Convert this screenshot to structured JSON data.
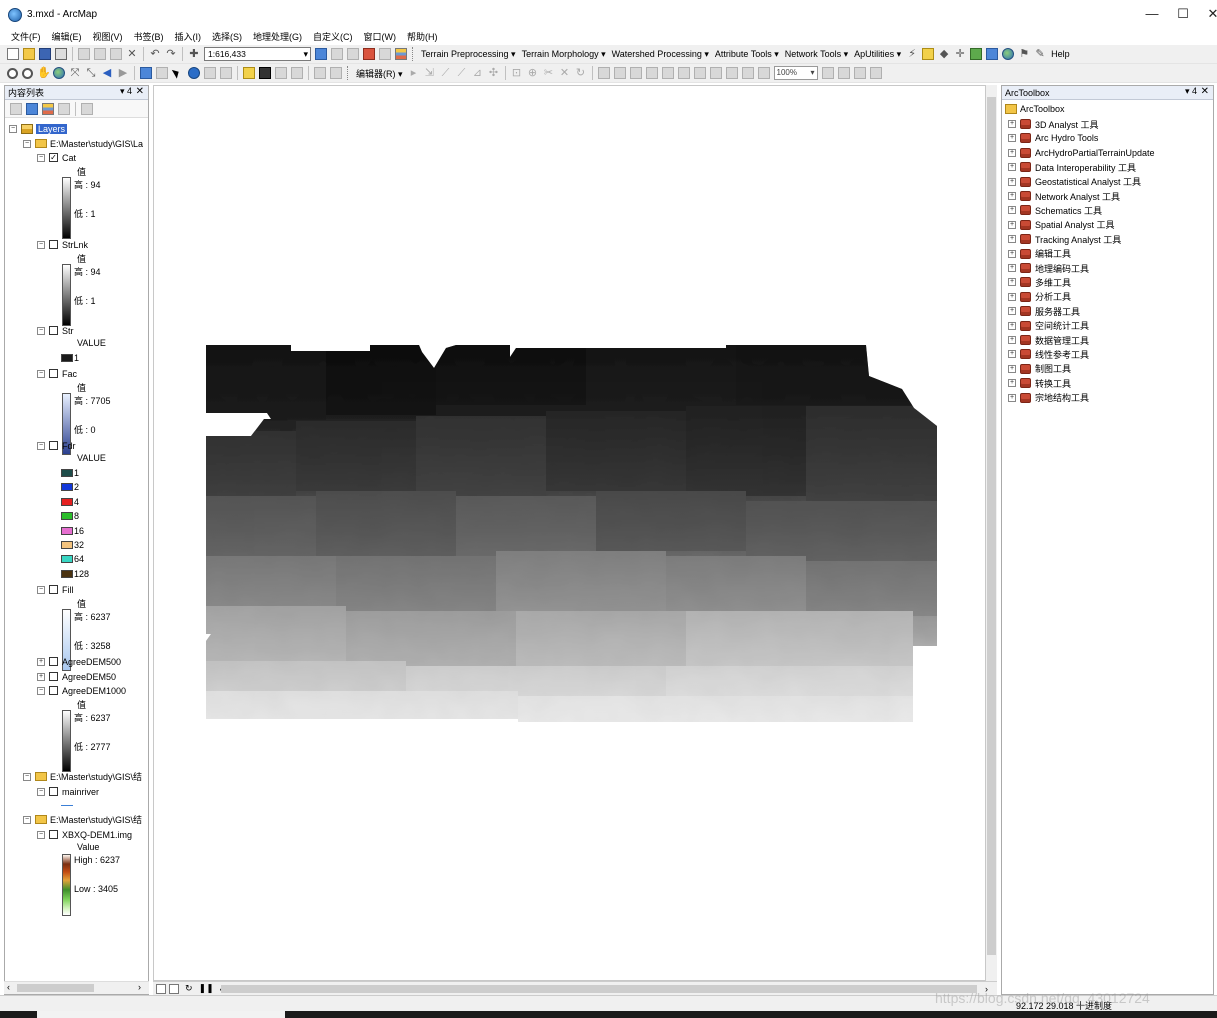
{
  "window": {
    "title": "3.mxd - ArcMap",
    "min": "—",
    "max": "☐",
    "close": "✕"
  },
  "menu": [
    "文件(F)",
    "编辑(E)",
    "视图(V)",
    "书签(B)",
    "插入(I)",
    "选择(S)",
    "地理处理(G)",
    "自定义(C)",
    "窗口(W)",
    "帮助(H)"
  ],
  "toolbar1": {
    "scale": "1:616,433",
    "menus": [
      "Terrain Preprocessing ▾",
      "Terrain Morphology ▾",
      "Watershed Processing ▾",
      "Attribute Tools ▾",
      "Network Tools ▾",
      "ApUtilities ▾"
    ],
    "help": "Help"
  },
  "toolbar2": {
    "editor": "编辑器(R) ▾",
    "zoom": "100%"
  },
  "toc": {
    "title": "内容列表",
    "pin": "▾ 4",
    "close": "✕",
    "root": "Layers",
    "groups": [
      {
        "path": "E:\\Master\\study\\GIS\\La"
      },
      {
        "path": "E:\\Master\\study\\GIS\\结"
      },
      {
        "path": "E:\\Master\\study\\GIS\\结"
      }
    ],
    "layers": {
      "cat": {
        "name": "Cat",
        "checked": "✓",
        "hdr": "值",
        "hi": "高 : 94",
        "lo": "低 : 1"
      },
      "strlnk": {
        "name": "StrLnk",
        "hdr": "值",
        "hi": "高 : 94",
        "lo": "低 : 1"
      },
      "str": {
        "name": "Str",
        "hdr": "VALUE",
        "values": [
          "1"
        ]
      },
      "fac": {
        "name": "Fac",
        "hdr": "值",
        "hi": "高 : 7705",
        "lo": "低 : 0"
      },
      "fdr": {
        "name": "Fdr",
        "hdr": "VALUE",
        "values": [
          "1",
          "2",
          "4",
          "8",
          "16",
          "32",
          "64",
          "128"
        ],
        "colors": [
          "#1e4d4a",
          "#1238d9",
          "#e52020",
          "#2bbd2b",
          "#e66fd0",
          "#f3c37e",
          "#38d6c3",
          "#4a3210"
        ]
      },
      "fill": {
        "name": "Fill",
        "hdr": "值",
        "hi": "高 : 6237",
        "lo": "低 : 3258"
      },
      "agree500": {
        "name": "AgreeDEM500"
      },
      "agree50": {
        "name": "AgreeDEM50"
      },
      "agree1000": {
        "name": "AgreeDEM1000",
        "hdr": "值",
        "hi": "高 : 6237",
        "lo": "低 : 2777"
      },
      "mainriver": {
        "name": "mainriver"
      },
      "dem": {
        "name": "XBXQ-DEM1.img",
        "hdr": "Value",
        "hi": "High : 6237",
        "lo": "Low : 3405"
      }
    }
  },
  "toolbox": {
    "title": "ArcToolbox",
    "pin": "▾ 4",
    "close": "✕",
    "root": "ArcToolbox",
    "items": [
      "3D Analyst 工具",
      "Arc Hydro Tools",
      "ArcHydroPartialTerrainUpdate",
      "Data Interoperability 工具",
      "Geostatistical Analyst 工具",
      "Network Analyst 工具",
      "Schematics 工具",
      "Spatial Analyst 工具",
      "Tracking Analyst 工具",
      "编辑工具",
      "地理编码工具",
      "多维工具",
      "分析工具",
      "服务器工具",
      "空间统计工具",
      "数据管理工具",
      "线性参考工具",
      "制图工具",
      "转换工具",
      "宗地结构工具"
    ]
  },
  "status": {
    "coords": "92.172  29.018 十进制度"
  },
  "watermark": "https://blog.csdn.net/qq_43012724"
}
